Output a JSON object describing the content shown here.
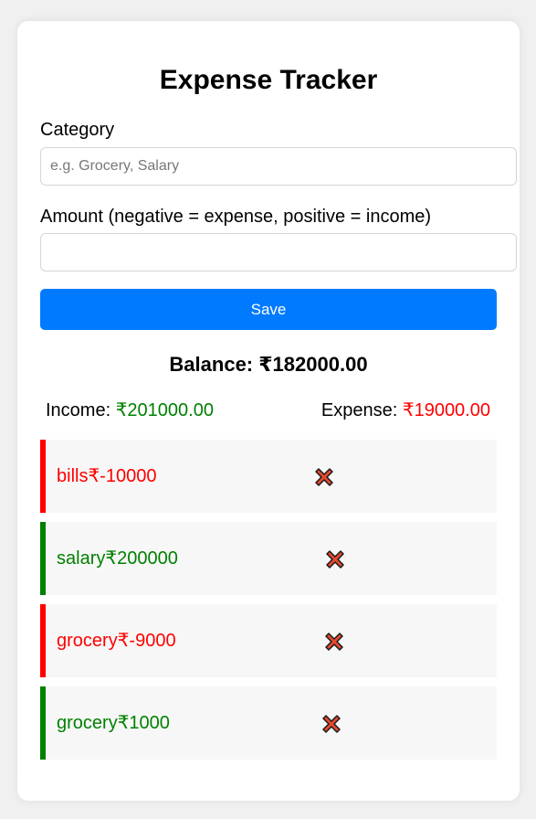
{
  "title": "Expense Tracker",
  "form": {
    "category_label": "Category",
    "category_placeholder": "e.g. Grocery, Salary",
    "category_value": "",
    "amount_label": "Amount (negative = expense, positive = income)",
    "amount_placeholder": "",
    "amount_value": "",
    "save_label": "Save"
  },
  "balance": {
    "label": "Balance: ",
    "value": "₹182000.00"
  },
  "summary": {
    "income_label": "Income: ",
    "income_value": "₹201000.00",
    "expense_label": "Expense: ",
    "expense_value": "₹19000.00"
  },
  "transactions": [
    {
      "text": "bills₹-10000",
      "type": "expense",
      "delete_icon": "cross-mark-icon"
    },
    {
      "text": "salary₹200000",
      "type": "income",
      "delete_icon": "cross-mark-icon"
    },
    {
      "text": "grocery₹-9000",
      "type": "expense",
      "delete_icon": "cross-mark-icon"
    },
    {
      "text": "grocery₹1000",
      "type": "income",
      "delete_icon": "cross-mark-icon"
    }
  ],
  "colors": {
    "accent": "#007bff",
    "income": "#008000",
    "expense": "#ff0000",
    "delete_icon": "#e34a2f"
  }
}
